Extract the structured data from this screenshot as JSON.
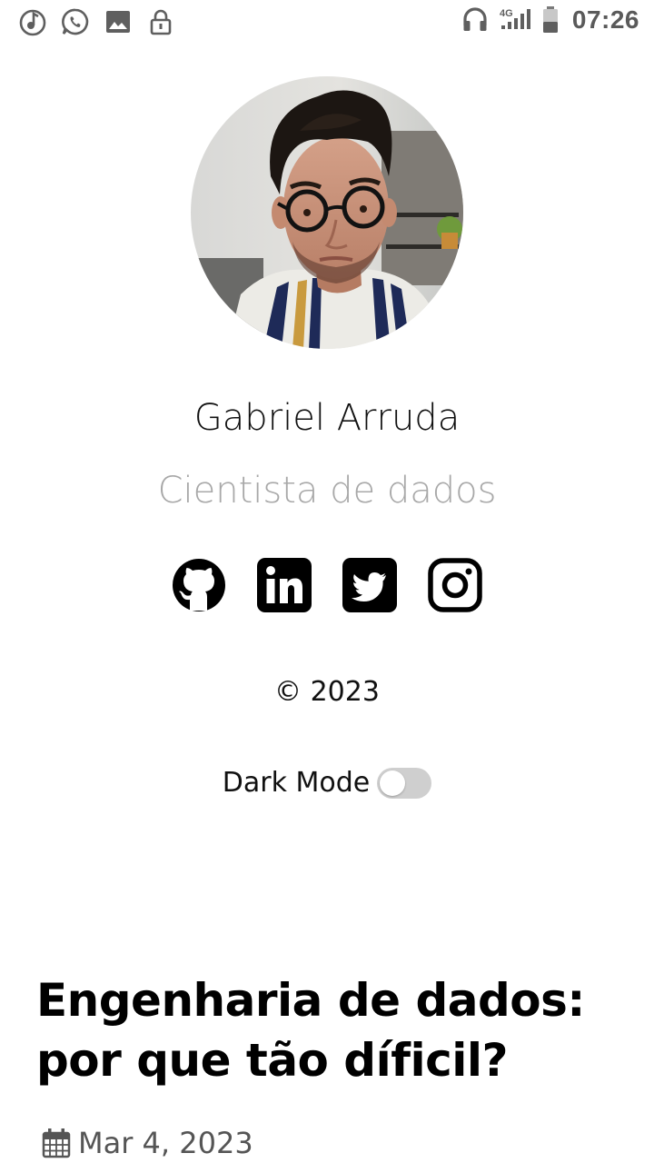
{
  "status_bar": {
    "time": "07:26",
    "network": "4G",
    "left_icons": [
      "music-note-icon",
      "whatsapp-icon",
      "image-icon",
      "lock-icon"
    ],
    "right_icons": [
      "headphones-icon",
      "signal-icon",
      "battery-icon"
    ]
  },
  "profile": {
    "name": "Gabriel Arruda",
    "role": "Cientista de dados",
    "avatar_icon": "profile-photo"
  },
  "social": [
    {
      "icon": "github-icon"
    },
    {
      "icon": "linkedin-icon"
    },
    {
      "icon": "twitter-icon"
    },
    {
      "icon": "instagram-icon"
    }
  ],
  "footer": {
    "copyright": "© 2023"
  },
  "dark_mode": {
    "label": "Dark Mode",
    "enabled": false
  },
  "post": {
    "title": "Engenharia de dados: por que tão díficil?",
    "date": "Mar 4, 2023",
    "date_icon": "calendar-icon"
  },
  "colors": {
    "background": "#ffffff",
    "text": "#111111",
    "muted": "#a8a8a8",
    "toggle_off": "#cfcfcf"
  }
}
